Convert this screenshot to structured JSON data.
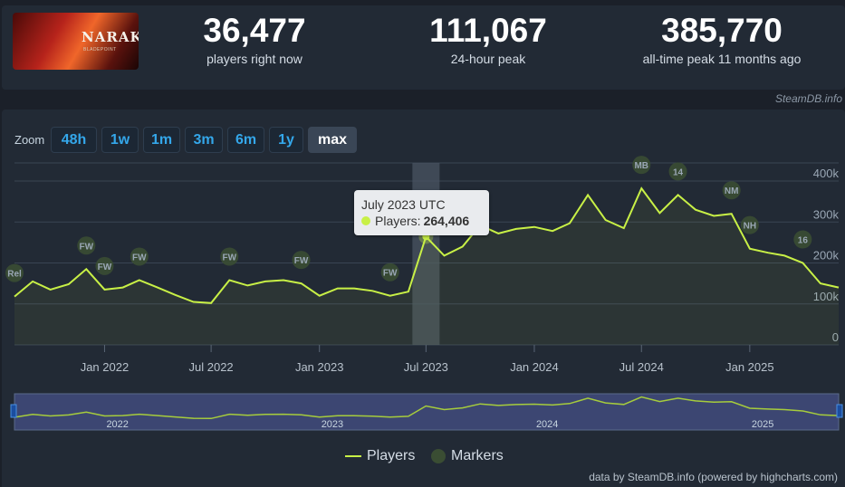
{
  "game": {
    "logo_text": "NARAKA",
    "logo_sub": "BLADEPOINT"
  },
  "stats": [
    {
      "value": "36,477",
      "label": "players right now"
    },
    {
      "value": "111,067",
      "label": "24-hour peak"
    },
    {
      "value": "385,770",
      "label": "all-time peak 11 months ago"
    }
  ],
  "credit_top": "SteamDB.info",
  "zoom": {
    "label": "Zoom",
    "options": [
      "48h",
      "1w",
      "1m",
      "3m",
      "6m",
      "1y",
      "max"
    ],
    "active": "max"
  },
  "tooltip": {
    "title": "July 2023 UTC",
    "series": "Players:",
    "value": "264,406"
  },
  "legend": {
    "players": "Players",
    "markers": "Markers"
  },
  "credit_bottom": "data by SteamDB.info (powered by highcharts.com)",
  "colors": {
    "line": "#c8f046",
    "accent": "#34a7ea",
    "marker": "#3a4d33"
  },
  "chart_data": {
    "type": "line",
    "series": [
      {
        "name": "Players",
        "x": [
          "2021-08",
          "2021-09",
          "2021-10",
          "2021-11",
          "2021-12",
          "2022-01",
          "2022-02",
          "2022-03",
          "2022-04",
          "2022-05",
          "2022-06",
          "2022-07",
          "2022-08",
          "2022-09",
          "2022-10",
          "2022-11",
          "2022-12",
          "2023-01",
          "2023-02",
          "2023-03",
          "2023-04",
          "2023-05",
          "2023-06",
          "2023-07",
          "2023-08",
          "2023-09",
          "2023-10",
          "2023-11",
          "2023-12",
          "2024-01",
          "2024-02",
          "2024-03",
          "2024-04",
          "2024-05",
          "2024-06",
          "2024-07",
          "2024-08",
          "2024-09",
          "2024-10",
          "2024-11",
          "2024-12",
          "2025-01",
          "2025-02",
          "2025-03",
          "2025-04",
          "2025-05",
          "2025-06"
        ],
        "values": [
          118000,
          155000,
          135000,
          148000,
          185000,
          135000,
          140000,
          158000,
          140000,
          122000,
          105000,
          102000,
          158000,
          145000,
          155000,
          158000,
          150000,
          120000,
          138000,
          138000,
          132000,
          120000,
          130000,
          264406,
          218000,
          240000,
          292000,
          272000,
          283000,
          288000,
          278000,
          297000,
          366000,
          305000,
          285000,
          382000,
          322000,
          366000,
          330000,
          315000,
          320000,
          235000,
          225000,
          218000,
          200000,
          150000,
          140000
        ]
      }
    ],
    "x_ticks": [
      "Jan 2022",
      "Jul 2022",
      "Jan 2023",
      "Jul 2023",
      "Jan 2024",
      "Jul 2024",
      "Jan 2025"
    ],
    "y_ticks": [
      "0",
      "100k",
      "200k",
      "300k",
      "400k"
    ],
    "ylim": [
      0,
      400000
    ],
    "markers": [
      {
        "label": "Rel",
        "x": "2021-08"
      },
      {
        "label": "FW",
        "x": "2021-12"
      },
      {
        "label": "FW",
        "x": "2022-01"
      },
      {
        "label": "FW",
        "x": "2022-03"
      },
      {
        "label": "FW",
        "x": "2022-08"
      },
      {
        "label": "FW",
        "x": "2022-12"
      },
      {
        "label": "FW",
        "x": "2023-05"
      },
      {
        "label": "MB",
        "x": "2024-07"
      },
      {
        "label": "14",
        "x": "2024-09"
      },
      {
        "label": "NM",
        "x": "2024-12"
      },
      {
        "label": "NH",
        "x": "2025-01"
      },
      {
        "label": "16",
        "x": "2025-04"
      }
    ],
    "navigator_labels": [
      "2022",
      "2023",
      "2024",
      "2025"
    ],
    "legend_position": "bottom"
  }
}
